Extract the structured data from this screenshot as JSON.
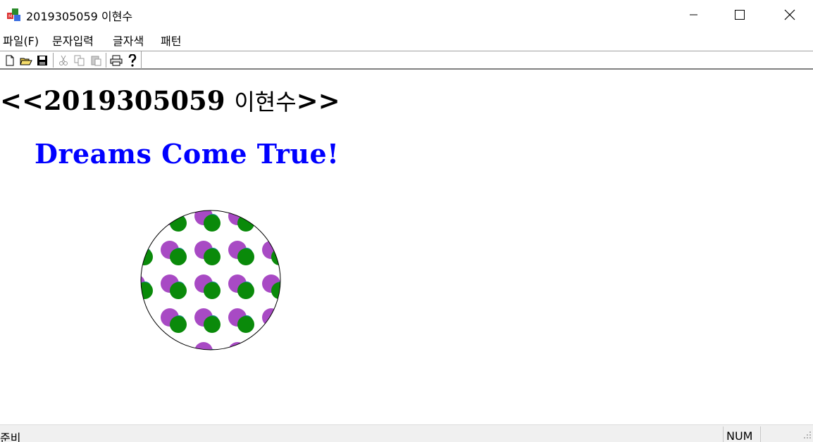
{
  "window": {
    "title": "2019305059 이현수",
    "icon": "mfc-app-icon"
  },
  "menubar": {
    "items": [
      {
        "label": "파일(F)"
      },
      {
        "label": "문자입력"
      },
      {
        "label": "글자색"
      },
      {
        "label": "패턴"
      }
    ]
  },
  "toolbar": {
    "buttons": [
      "new-icon",
      "open-icon",
      "save-icon",
      "cut-icon",
      "copy-icon",
      "paste-icon",
      "print-icon",
      "help-icon"
    ]
  },
  "canvas": {
    "heading_prefix": "<<2019305059 ",
    "heading_name": "이현수",
    "heading_suffix": ">>",
    "dreams_text": "Dreams Come True!",
    "dreams_color": "#0000ff",
    "pattern_colors": {
      "purple": "#a84ac4",
      "teal": "#1a8c8c",
      "green": "#0a8a0a"
    }
  },
  "statusbar": {
    "text": "준비",
    "num": "NUM"
  }
}
